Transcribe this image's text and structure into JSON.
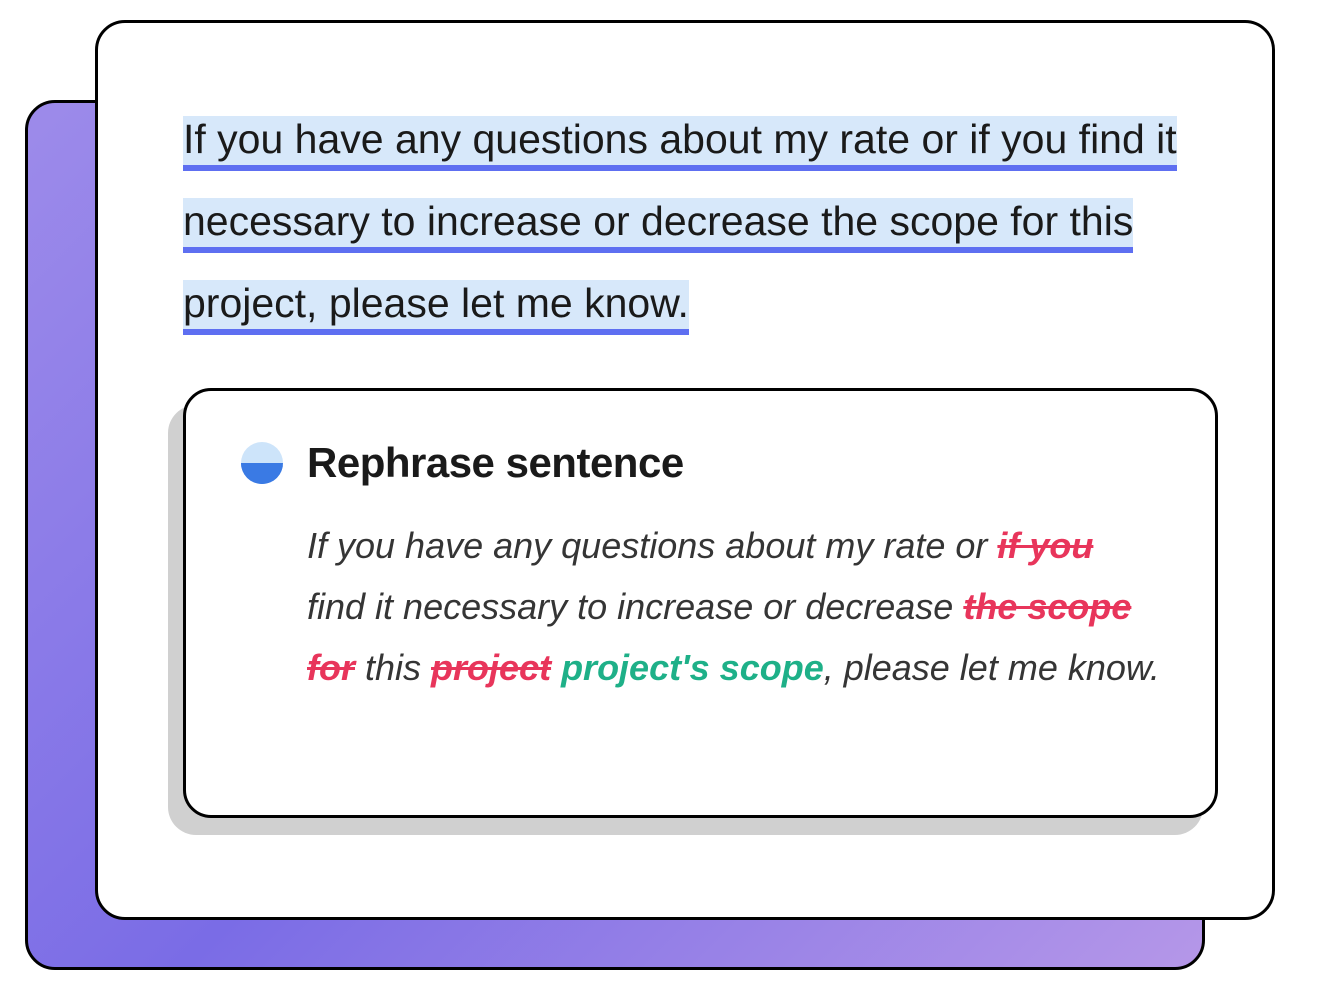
{
  "original_sentence": "If you have any questions about my rate or if you find it necessary to increase or decrease the scope for this project, please let me know.",
  "suggestion": {
    "title": "Rephrase sentence",
    "parts": {
      "p1": "If you have any questions about my rate or ",
      "s1": "if you",
      "p2": " find it necessary to increase or decrease ",
      "s2": "the scope for",
      "p3": " this ",
      "s3": "project",
      "i1": " project's scope",
      "p4": ", please let me know."
    }
  },
  "colors": {
    "highlight_bg": "#d7e8fa",
    "underline": "#5e6ff1",
    "strike": "#e8355b",
    "insert": "#1eb088"
  }
}
